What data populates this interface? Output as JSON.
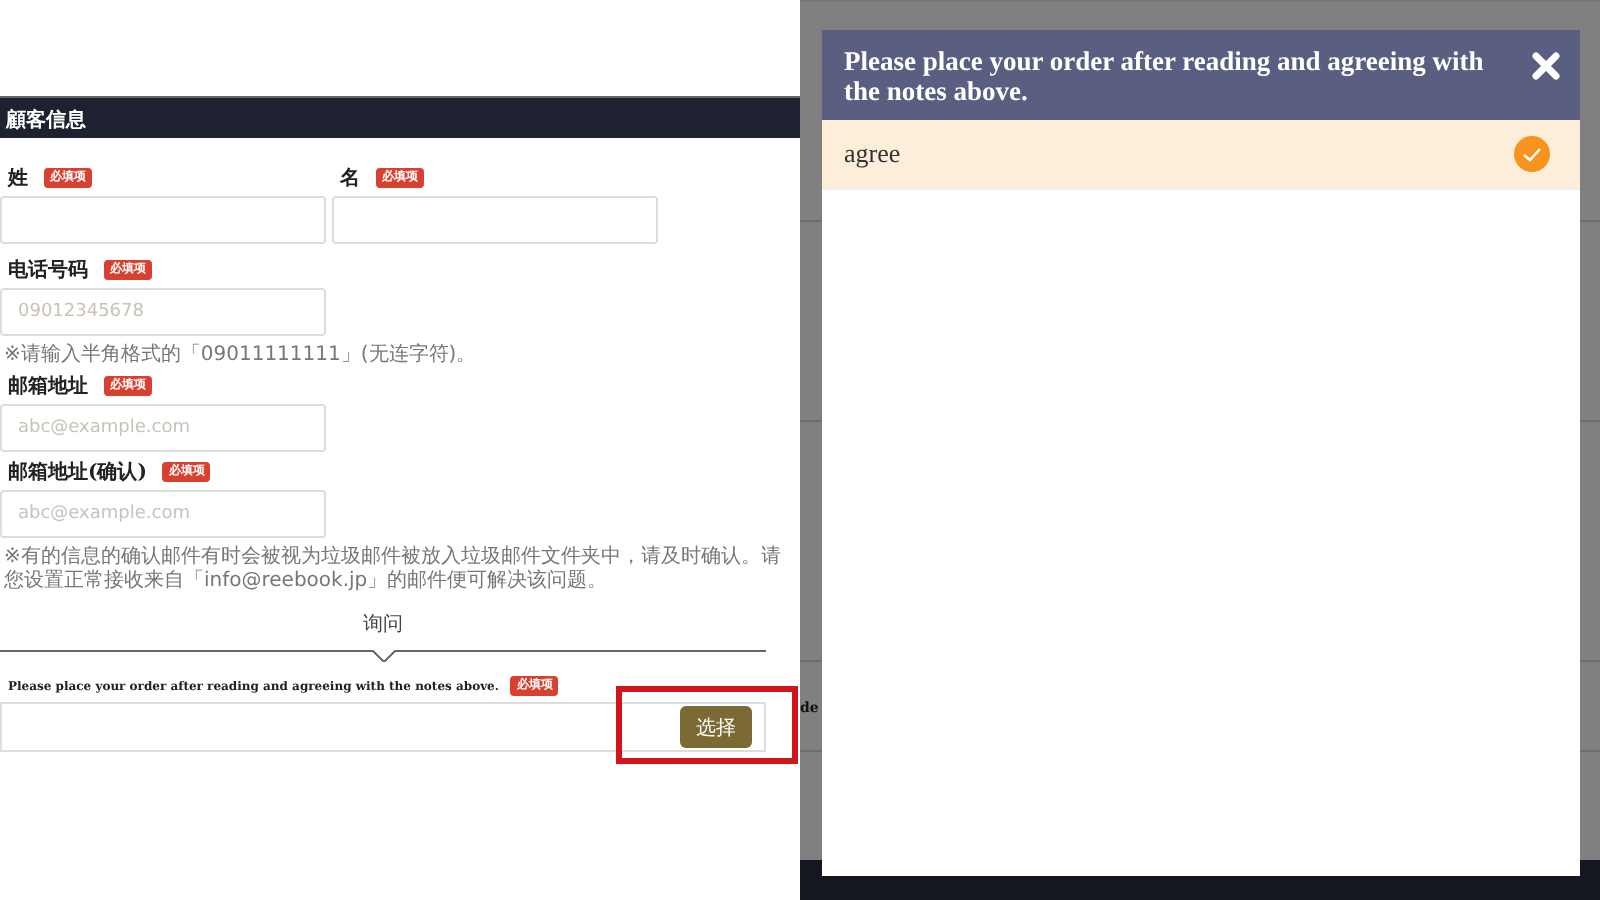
{
  "form": {
    "section_title": "顧客信息",
    "name_fields": [
      {
        "label": "姓",
        "badge": "必填项"
      },
      {
        "label": "名",
        "badge": "必填项"
      }
    ],
    "fields": [
      {
        "label": "电话号码",
        "badge": "必填项",
        "placeholder": "09012345678",
        "note": "※请输入半角格式的「09011111111」(无连字符)。"
      },
      {
        "label": "邮箱地址",
        "badge": "必填项",
        "placeholder": "abc@example.com"
      },
      {
        "label": "邮箱地址(确认)",
        "badge": "必填项",
        "placeholder": "abc@example.com",
        "note": "※有的信息的确认邮件有时会被视为垃圾邮件被放入垃圾邮件文件夹中，请及时确认。请您设置正常接收来自「info@reebook.jp」的邮件便可解决该问题。"
      }
    ],
    "inquiry_heading": "询问",
    "agreement": {
      "label": "Please place your order after reading and agreeing with the notes above.",
      "badge": "必填项",
      "button": "选择"
    }
  },
  "backdrop": {
    "fragment": "de"
  },
  "modal": {
    "title": "Please place your order after reading and agreeing with the notes above.",
    "options": [
      {
        "label": "agree",
        "selected": true
      }
    ]
  }
}
